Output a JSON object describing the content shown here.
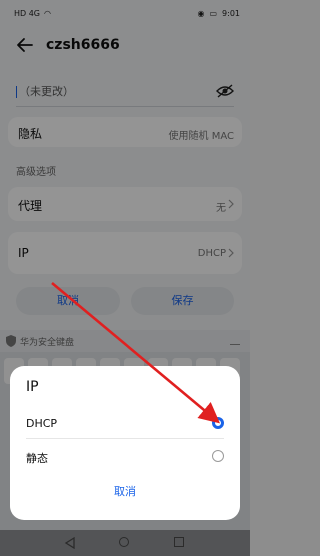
{
  "status": {
    "left_text": "HD 4G",
    "time": "9:01"
  },
  "header": {
    "title": "czsh6666"
  },
  "password": {
    "value": "（未更改）"
  },
  "privacy": {
    "label": "隐私",
    "value": "使用随机 MAC"
  },
  "advanced": {
    "title": "高级选项"
  },
  "proxy": {
    "label": "代理",
    "value": "无"
  },
  "ip": {
    "label": "IP",
    "value": "DHCP"
  },
  "buttons": {
    "cancel": "取消",
    "save": "保存"
  },
  "keyboard": {
    "label": "华为安全键盘"
  },
  "dialog": {
    "title": "IP",
    "options": [
      {
        "label": "DHCP",
        "selected": true
      },
      {
        "label": "静态",
        "selected": false
      }
    ],
    "cancel": "取消"
  },
  "colors": {
    "accent": "#1a63e8",
    "annotation": "#e02020"
  }
}
